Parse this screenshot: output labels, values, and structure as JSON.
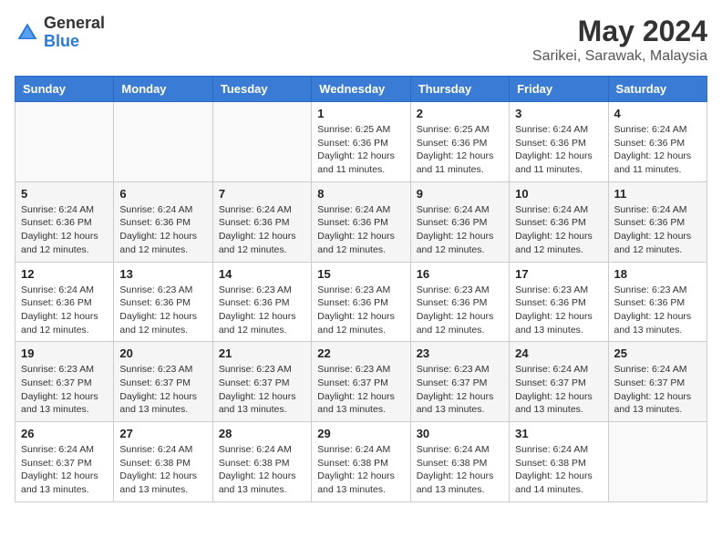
{
  "logo": {
    "general": "General",
    "blue": "Blue"
  },
  "title": {
    "month_year": "May 2024",
    "location": "Sarikei, Sarawak, Malaysia"
  },
  "headers": [
    "Sunday",
    "Monday",
    "Tuesday",
    "Wednesday",
    "Thursday",
    "Friday",
    "Saturday"
  ],
  "weeks": [
    [
      {
        "day": "",
        "info": ""
      },
      {
        "day": "",
        "info": ""
      },
      {
        "day": "",
        "info": ""
      },
      {
        "day": "1",
        "info": "Sunrise: 6:25 AM\nSunset: 6:36 PM\nDaylight: 12 hours and 11 minutes."
      },
      {
        "day": "2",
        "info": "Sunrise: 6:25 AM\nSunset: 6:36 PM\nDaylight: 12 hours and 11 minutes."
      },
      {
        "day": "3",
        "info": "Sunrise: 6:24 AM\nSunset: 6:36 PM\nDaylight: 12 hours and 11 minutes."
      },
      {
        "day": "4",
        "info": "Sunrise: 6:24 AM\nSunset: 6:36 PM\nDaylight: 12 hours and 11 minutes."
      }
    ],
    [
      {
        "day": "5",
        "info": "Sunrise: 6:24 AM\nSunset: 6:36 PM\nDaylight: 12 hours and 12 minutes."
      },
      {
        "day": "6",
        "info": "Sunrise: 6:24 AM\nSunset: 6:36 PM\nDaylight: 12 hours and 12 minutes."
      },
      {
        "day": "7",
        "info": "Sunrise: 6:24 AM\nSunset: 6:36 PM\nDaylight: 12 hours and 12 minutes."
      },
      {
        "day": "8",
        "info": "Sunrise: 6:24 AM\nSunset: 6:36 PM\nDaylight: 12 hours and 12 minutes."
      },
      {
        "day": "9",
        "info": "Sunrise: 6:24 AM\nSunset: 6:36 PM\nDaylight: 12 hours and 12 minutes."
      },
      {
        "day": "10",
        "info": "Sunrise: 6:24 AM\nSunset: 6:36 PM\nDaylight: 12 hours and 12 minutes."
      },
      {
        "day": "11",
        "info": "Sunrise: 6:24 AM\nSunset: 6:36 PM\nDaylight: 12 hours and 12 minutes."
      }
    ],
    [
      {
        "day": "12",
        "info": "Sunrise: 6:24 AM\nSunset: 6:36 PM\nDaylight: 12 hours and 12 minutes."
      },
      {
        "day": "13",
        "info": "Sunrise: 6:23 AM\nSunset: 6:36 PM\nDaylight: 12 hours and 12 minutes."
      },
      {
        "day": "14",
        "info": "Sunrise: 6:23 AM\nSunset: 6:36 PM\nDaylight: 12 hours and 12 minutes."
      },
      {
        "day": "15",
        "info": "Sunrise: 6:23 AM\nSunset: 6:36 PM\nDaylight: 12 hours and 12 minutes."
      },
      {
        "day": "16",
        "info": "Sunrise: 6:23 AM\nSunset: 6:36 PM\nDaylight: 12 hours and 12 minutes."
      },
      {
        "day": "17",
        "info": "Sunrise: 6:23 AM\nSunset: 6:36 PM\nDaylight: 12 hours and 13 minutes."
      },
      {
        "day": "18",
        "info": "Sunrise: 6:23 AM\nSunset: 6:36 PM\nDaylight: 12 hours and 13 minutes."
      }
    ],
    [
      {
        "day": "19",
        "info": "Sunrise: 6:23 AM\nSunset: 6:37 PM\nDaylight: 12 hours and 13 minutes."
      },
      {
        "day": "20",
        "info": "Sunrise: 6:23 AM\nSunset: 6:37 PM\nDaylight: 12 hours and 13 minutes."
      },
      {
        "day": "21",
        "info": "Sunrise: 6:23 AM\nSunset: 6:37 PM\nDaylight: 12 hours and 13 minutes."
      },
      {
        "day": "22",
        "info": "Sunrise: 6:23 AM\nSunset: 6:37 PM\nDaylight: 12 hours and 13 minutes."
      },
      {
        "day": "23",
        "info": "Sunrise: 6:23 AM\nSunset: 6:37 PM\nDaylight: 12 hours and 13 minutes."
      },
      {
        "day": "24",
        "info": "Sunrise: 6:24 AM\nSunset: 6:37 PM\nDaylight: 12 hours and 13 minutes."
      },
      {
        "day": "25",
        "info": "Sunrise: 6:24 AM\nSunset: 6:37 PM\nDaylight: 12 hours and 13 minutes."
      }
    ],
    [
      {
        "day": "26",
        "info": "Sunrise: 6:24 AM\nSunset: 6:37 PM\nDaylight: 12 hours and 13 minutes."
      },
      {
        "day": "27",
        "info": "Sunrise: 6:24 AM\nSunset: 6:38 PM\nDaylight: 12 hours and 13 minutes."
      },
      {
        "day": "28",
        "info": "Sunrise: 6:24 AM\nSunset: 6:38 PM\nDaylight: 12 hours and 13 minutes."
      },
      {
        "day": "29",
        "info": "Sunrise: 6:24 AM\nSunset: 6:38 PM\nDaylight: 12 hours and 13 minutes."
      },
      {
        "day": "30",
        "info": "Sunrise: 6:24 AM\nSunset: 6:38 PM\nDaylight: 12 hours and 13 minutes."
      },
      {
        "day": "31",
        "info": "Sunrise: 6:24 AM\nSunset: 6:38 PM\nDaylight: 12 hours and 14 minutes."
      },
      {
        "day": "",
        "info": ""
      }
    ]
  ]
}
